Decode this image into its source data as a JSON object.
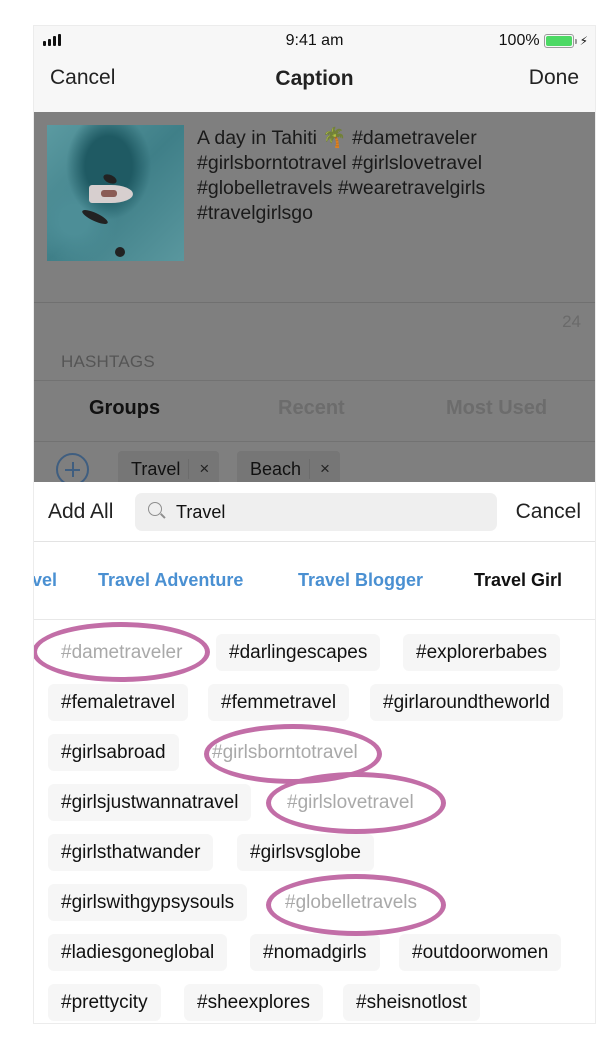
{
  "status_bar": {
    "time": "9:41 am",
    "battery_percent_label": "100%",
    "battery_level": 1.0,
    "battery_color": "#4cd964",
    "charging_icon": "bolt-icon",
    "signal_icon": "cellular-signal-icon"
  },
  "nav": {
    "cancel_label": "Cancel",
    "title": "Caption",
    "done_label": "Done"
  },
  "caption": {
    "thumbnail_alt": "Aerial photo of a boat and sharks in turquoise water",
    "text": "A day in Tahiti 🌴 #dametraveler #girlsborntotravel #girlslovetravel #globelletravels #wearetravelgirls #travelgirlsgo",
    "hashtag_count": "24"
  },
  "hashtags_section": {
    "label": "HASHTAGS",
    "tabs": [
      {
        "label": "Groups",
        "active": true
      },
      {
        "label": "Recent",
        "active": false
      },
      {
        "label": "Most Used",
        "active": false
      }
    ],
    "add_group_icon": "plus-circle-icon",
    "groups": [
      {
        "label": "Travel",
        "remove_label": "×"
      },
      {
        "label": "Beach",
        "remove_label": "×"
      }
    ]
  },
  "search": {
    "add_all_label": "Add All",
    "value": "Travel",
    "placeholder": "Search",
    "cancel_label": "Cancel"
  },
  "categories": [
    {
      "label": "vel",
      "state": "link"
    },
    {
      "label": "Travel Adventure",
      "state": "link"
    },
    {
      "label": "Travel Blogger",
      "state": "link"
    },
    {
      "label": "Travel Girl",
      "state": "current"
    }
  ],
  "accent_colors": {
    "link": "#4a90d2",
    "annotation_ring": "#c26ea7"
  },
  "tags": [
    {
      "label": "#dametraveler",
      "used": true
    },
    {
      "label": "#darlingescapes",
      "used": false
    },
    {
      "label": "#explorerbabes",
      "used": false
    },
    {
      "label": "#femaletravel",
      "used": false
    },
    {
      "label": "#femmetravel",
      "used": false
    },
    {
      "label": "#girlaroundtheworld",
      "used": false
    },
    {
      "label": "#girlsabroad",
      "used": false
    },
    {
      "label": "#girlsborntotravel",
      "used": true
    },
    {
      "label": "#girlsjustwannatravel",
      "used": false
    },
    {
      "label": "#girlslovetravel",
      "used": true
    },
    {
      "label": "#girlsthatwander",
      "used": false
    },
    {
      "label": "#girlsvsglobe",
      "used": false
    },
    {
      "label": "#girlswithgypsysouls",
      "used": false
    },
    {
      "label": "#globelletravels",
      "used": true
    },
    {
      "label": "#ladiesgoneglobal",
      "used": false
    },
    {
      "label": "#nomadgirls",
      "used": false
    },
    {
      "label": "#outdoorwomen",
      "used": false
    },
    {
      "label": "#prettycity",
      "used": false
    },
    {
      "label": "#sheexplores",
      "used": false
    },
    {
      "label": "#sheisnotlost",
      "used": false
    }
  ]
}
